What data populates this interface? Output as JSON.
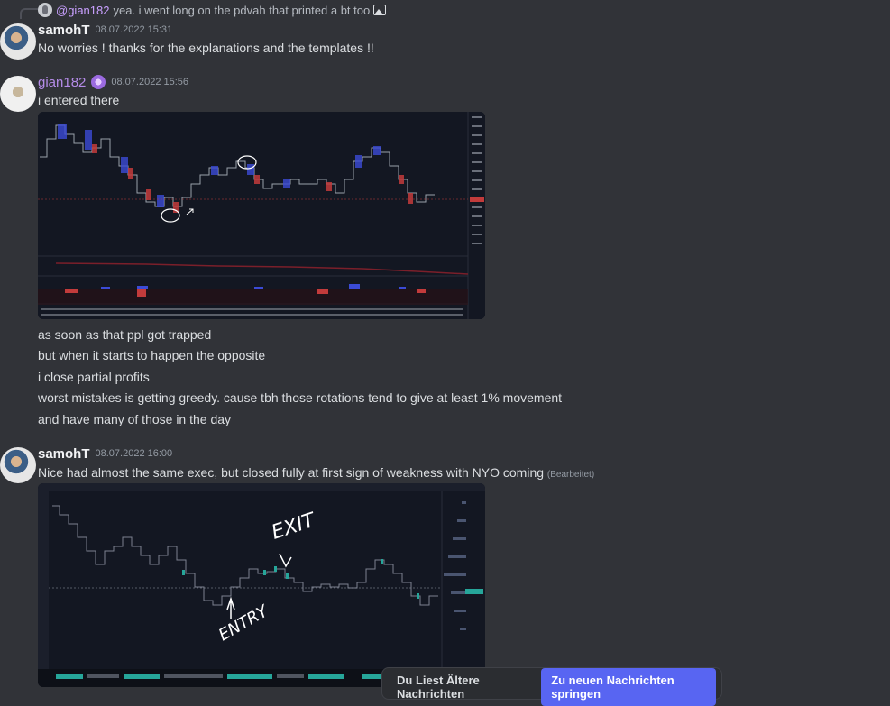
{
  "reply": {
    "mention": "@gian182",
    "text": "yea. i went long on the pdvah that printed a bt too"
  },
  "messages": [
    {
      "author": "samohT",
      "timestamp": "08.07.2022 15:31",
      "lines": [
        "No worries !  thanks for the explanations and the templates !!"
      ]
    },
    {
      "author": "gian182",
      "timestamp": "08.07.2022 15:56",
      "lines": [
        "i entered there",
        "as soon as that ppl got trapped",
        "but when it starts to happen the opposite",
        "i close partial profits",
        "worst mistakes is getting greedy. cause tbh those rotations tend to give at least 1% movement",
        "and have many of those in the day"
      ]
    },
    {
      "author": "samohT",
      "timestamp": "08.07.2022 16:00",
      "lines": [
        "Nice had almost the same exec, but closed fully at first sign of weakness with NYO coming"
      ],
      "edited": "(Bearbeitet)",
      "annotations": [
        "EXIT",
        "ENTRY"
      ]
    }
  ],
  "bottom_bar": {
    "text": "Du Liest Ältere Nachrichten",
    "button": "Zu neuen Nachrichten springen"
  },
  "colors": {
    "background": "#313338",
    "accent": "#5865f2",
    "mention": "#c9a0ff",
    "username_role": "#b58ce8"
  }
}
